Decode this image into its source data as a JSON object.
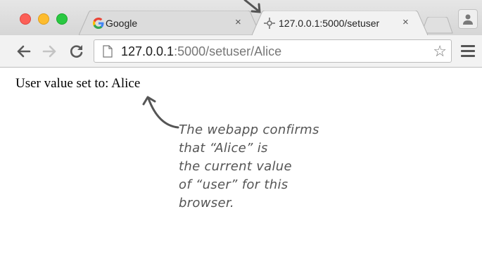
{
  "tabs": [
    {
      "label": "Google",
      "close": "×"
    },
    {
      "label": "127.0.0.1:5000/setuser",
      "close": "×"
    }
  ],
  "address_bar": {
    "host": "127.0.0.1",
    "path": ":5000/setuser/Alice"
  },
  "page": {
    "message": "User value set to: Alice"
  },
  "annotation": {
    "text": "The webapp confirms\nthat “Alice” is\nthe current value\nof “user” for this\nbrowser."
  },
  "icons": {
    "star": "☆"
  }
}
